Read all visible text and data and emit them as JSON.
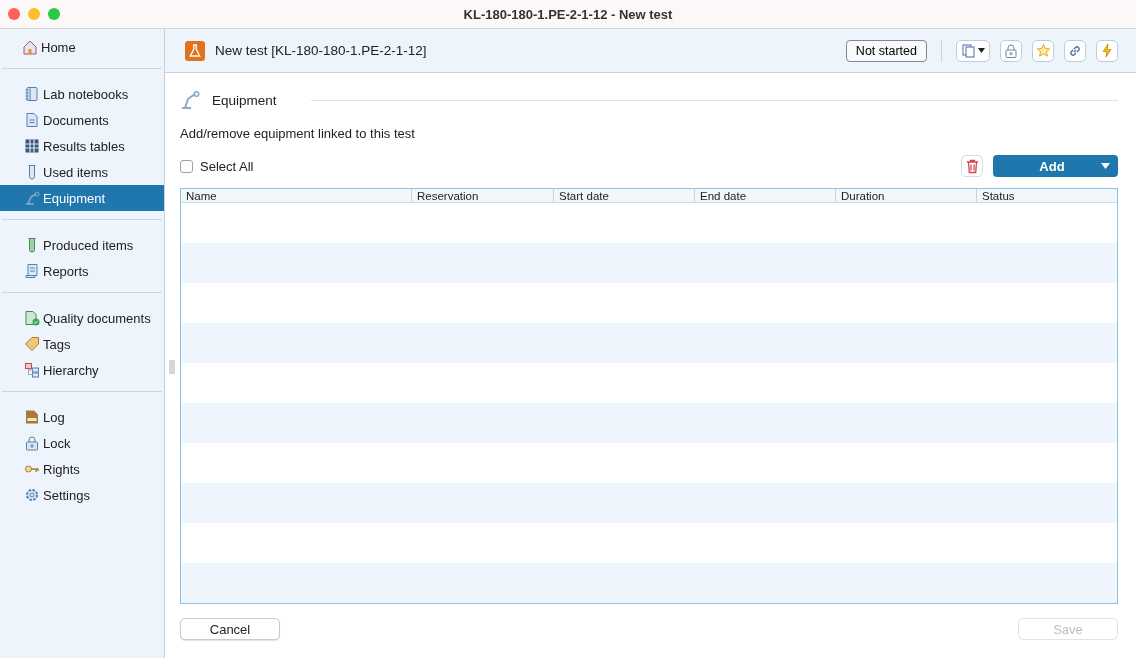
{
  "window": {
    "title": "KL-180-180-1.PE-2-1-12 - New test"
  },
  "sidebar": {
    "groups": [
      {
        "items": [
          {
            "label": "Home",
            "selected": false
          }
        ]
      },
      {
        "items": [
          {
            "label": "Lab notebooks",
            "selected": false
          },
          {
            "label": "Documents",
            "selected": false
          },
          {
            "label": "Results tables",
            "selected": false
          },
          {
            "label": "Used items",
            "selected": false
          },
          {
            "label": "Equipment",
            "selected": true
          }
        ]
      },
      {
        "items": [
          {
            "label": "Produced items",
            "selected": false
          },
          {
            "label": "Reports",
            "selected": false
          }
        ]
      },
      {
        "items": [
          {
            "label": "Quality documents",
            "selected": false
          },
          {
            "label": "Tags",
            "selected": false
          },
          {
            "label": "Hierarchy",
            "selected": false
          }
        ]
      },
      {
        "items": [
          {
            "label": "Log",
            "selected": false
          },
          {
            "label": "Lock",
            "selected": false
          },
          {
            "label": "Rights",
            "selected": false
          },
          {
            "label": "Settings",
            "selected": false
          }
        ]
      }
    ]
  },
  "header": {
    "title": "New test [KL-180-180-1.PE-2-1-12]",
    "status": "Not started"
  },
  "section": {
    "title": "Equipment",
    "description": "Add/remove equipment linked to this test",
    "select_all": {
      "label": "Select All",
      "checked": false
    },
    "add_button": "Add"
  },
  "table": {
    "columns": [
      "Name",
      "Reservation",
      "Start date",
      "End date",
      "Duration",
      "Status"
    ]
  },
  "footer": {
    "cancel": "Cancel",
    "save": {
      "label": "Save",
      "disabled": true
    }
  }
}
